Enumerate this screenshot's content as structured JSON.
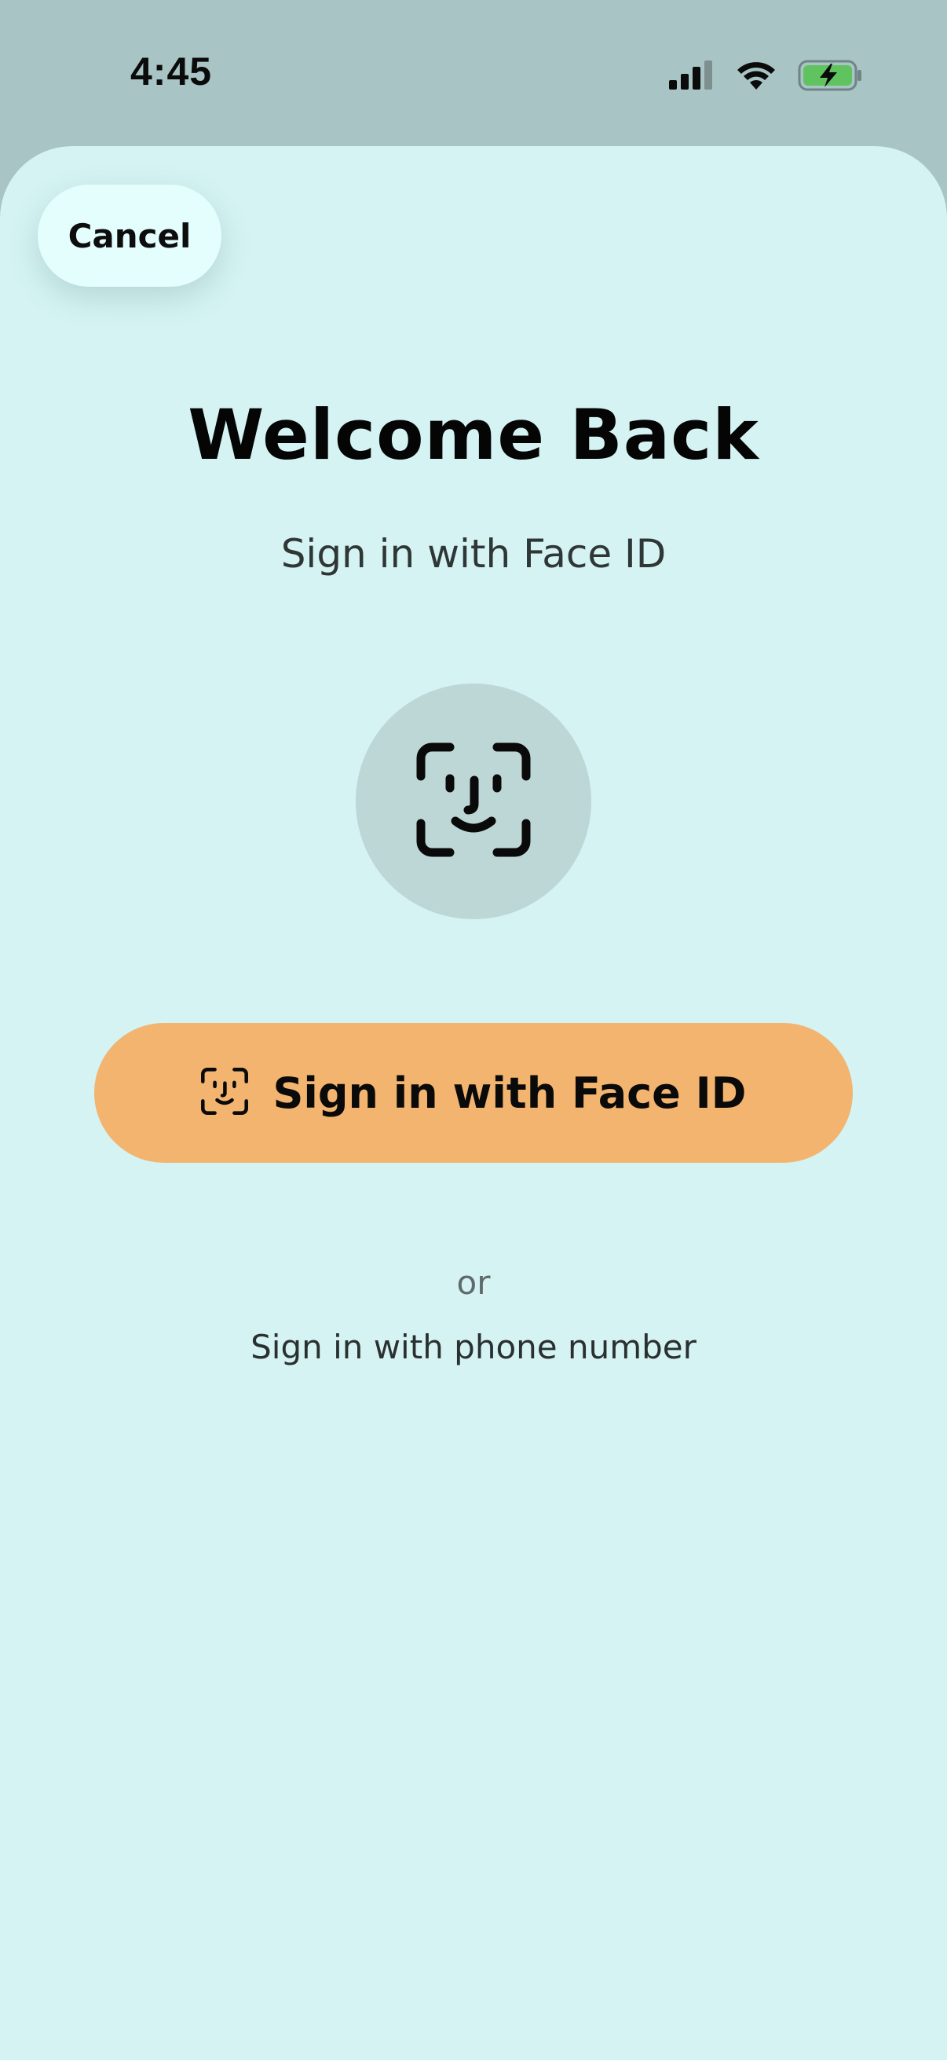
{
  "status_bar": {
    "time": "4:45",
    "icons": [
      "cellular-signal-icon",
      "wifi-icon",
      "battery-charging-icon"
    ],
    "battery_color": "#5fc45f"
  },
  "header": {
    "cancel_label": "Cancel"
  },
  "main": {
    "title": "Welcome Back",
    "subtitle": "Sign in with Face ID",
    "face_icon": "face-id-icon",
    "primary_button_label": "Sign in with Face ID",
    "divider_text": "or",
    "alt_signin_label": "Sign in with phone number"
  },
  "colors": {
    "sheet_background": "#d5f3f3",
    "status_background": "#a9c4c4",
    "primary_button": "#f2b46e",
    "face_circle": "#bdd7d7"
  }
}
